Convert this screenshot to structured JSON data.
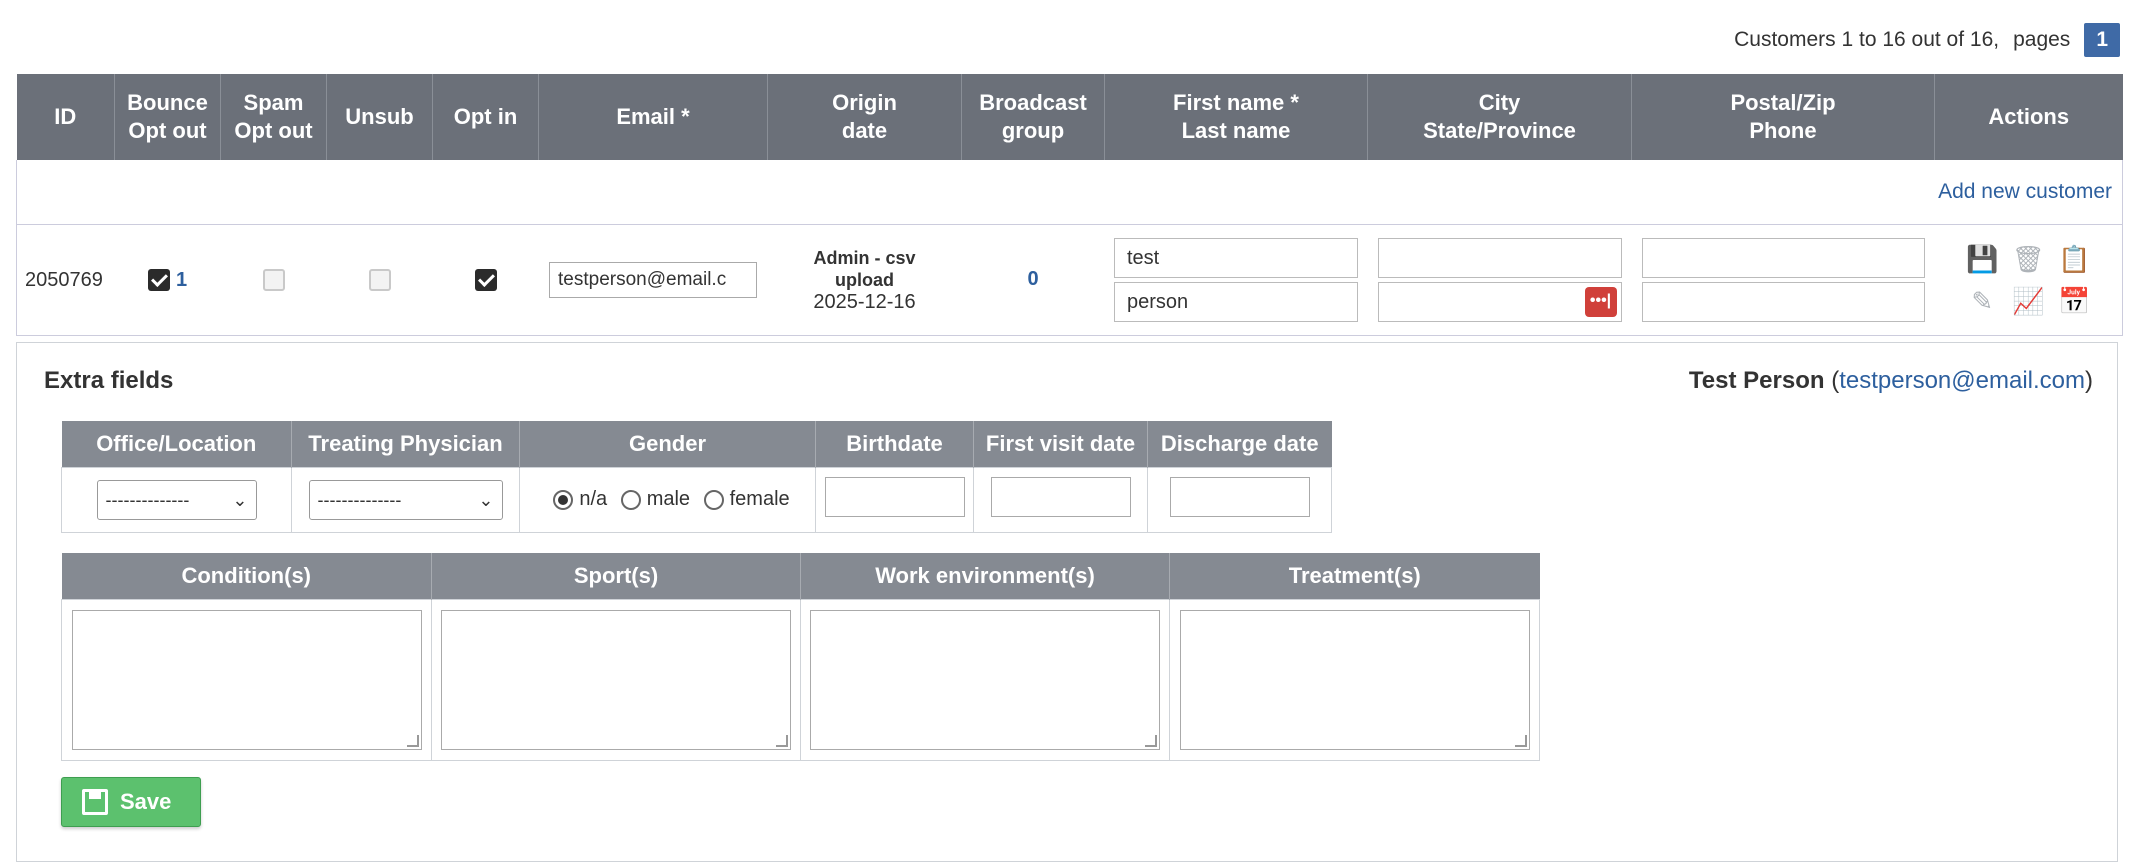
{
  "pagination": {
    "summary": "Customers 1 to 16 out of 16,",
    "pages_label": "pages",
    "current_page": "1"
  },
  "table": {
    "headers": [
      {
        "l1": "ID",
        "l2": ""
      },
      {
        "l1": "Bounce",
        "l2": "Opt out"
      },
      {
        "l1": "Spam",
        "l2": "Opt out"
      },
      {
        "l1": "Unsub",
        "l2": ""
      },
      {
        "l1": "Opt in",
        "l2": ""
      },
      {
        "l1": "Email *",
        "l2": ""
      },
      {
        "l1": "Origin",
        "l2": "date"
      },
      {
        "l1": "Broadcast",
        "l2": "group"
      },
      {
        "l1": "First name *",
        "l2": "Last name"
      },
      {
        "l1": "City",
        "l2": "State/Province"
      },
      {
        "l1": "Postal/Zip",
        "l2": "Phone"
      },
      {
        "l1": "Actions",
        "l2": ""
      }
    ],
    "add_new_label": "Add new customer",
    "row": {
      "id": "2050769",
      "bounce_count": "1",
      "email": "testperson@email.c",
      "origin_line1": "Admin - csv",
      "origin_line2": "upload",
      "origin_date": "2025-12-16",
      "broadcast_group": "0",
      "first_name": "test",
      "last_name": "person",
      "city": "",
      "state": "",
      "postal": "",
      "phone": "",
      "dots_label": "•••|"
    }
  },
  "extra": {
    "title": "Extra fields",
    "person_name": "Test Person",
    "person_email": "testperson@email.com",
    "fields1": {
      "office": "Office/Location",
      "physician": "Treating Physician",
      "gender": "Gender",
      "birthdate": "Birthdate",
      "first_visit": "First visit date",
      "discharge": "Discharge date"
    },
    "select_placeholder": "--------------",
    "gender_options": [
      "n/a",
      "male",
      "female"
    ],
    "fields2": {
      "conditions": "Condition(s)",
      "sports": "Sport(s)",
      "work": "Work environment(s)",
      "treatments": "Treatment(s)"
    },
    "save_label": "Save"
  }
}
